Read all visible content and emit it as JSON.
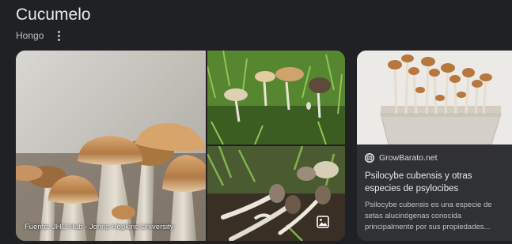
{
  "entity": {
    "title": "Cucumelo",
    "subtitle": "Hongo"
  },
  "gallery": {
    "main_caption": "Fuente: JHU Hub - Johns Hopkins University",
    "image_icon": "image-icon",
    "more_icon": "more-vert-icon"
  },
  "result": {
    "site": "GrowBarato.net",
    "favicon": "globe-icon",
    "title": "Psilocybe cubensis y otras especies de psylocibes",
    "snippet": "Psilocybe cubensis es una especie de setas alucinógenas conocida principalmente por sus propiedades..."
  }
}
